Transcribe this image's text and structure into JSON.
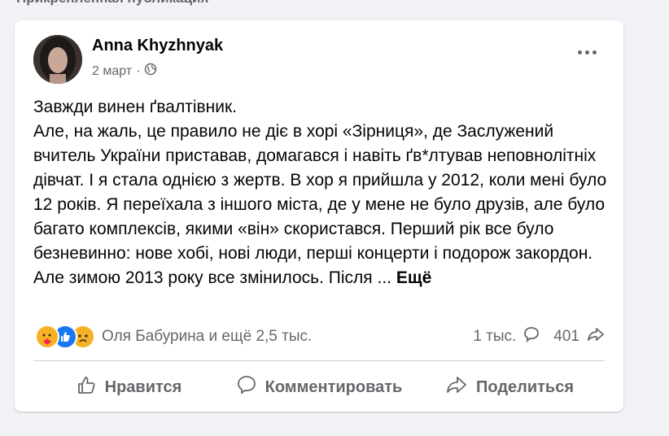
{
  "header": {
    "label": "Прикреплённая публикация"
  },
  "post": {
    "author": "Anna Khyzhnyak",
    "date": "2 март",
    "separator": "·",
    "paragraphs": [
      "Завжди винен ґвалтівник.",
      "Але, на жаль, це правило не діє в хорі «Зірниця», де Заслужений вчитель України приставав, домагався і навіть ґв*лтував неповнолітніх дівчат. І я стала однією з жертв. В хор я прийшла у 2012, коли мені було 12 років. Я переїхала з іншого міста, де у мене не було друзів, але було багато комплексів, якими «він» скористався. Перший рік все було безневинно: нове хобі, нові люди, перші концерти і подорож закордон. Але зимою 2013 року все змінилось. Після ..."
    ],
    "see_more": "Ещё",
    "reactions_text": "Оля Бабурина и ещё 2,5 тыс.",
    "comments_count": "1 тыс.",
    "shares_count": "401"
  },
  "actions": {
    "like": "Нравится",
    "comment": "Комментировать",
    "share": "Поделиться"
  },
  "colors": {
    "text": "#050505",
    "muted": "#65676b",
    "like_blue": "#1877f2",
    "care_yellow": "#f7b125"
  },
  "icons": [
    "globe-icon",
    "more-icon",
    "care-reaction-icon",
    "like-reaction-icon",
    "sad-reaction-icon",
    "comment-icon",
    "share-icon",
    "like-icon"
  ]
}
